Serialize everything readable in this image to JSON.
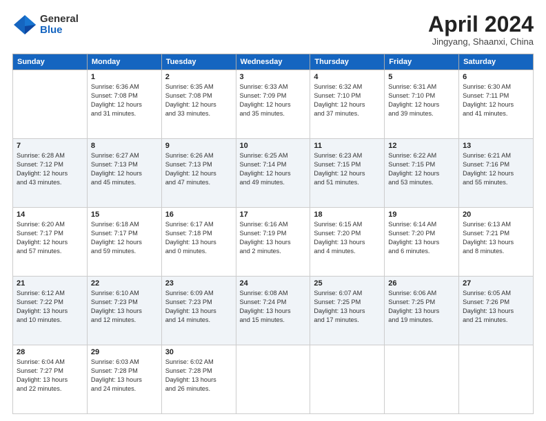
{
  "header": {
    "logo_general": "General",
    "logo_blue": "Blue",
    "title": "April 2024",
    "location": "Jingyang, Shaanxi, China"
  },
  "weekdays": [
    "Sunday",
    "Monday",
    "Tuesday",
    "Wednesday",
    "Thursday",
    "Friday",
    "Saturday"
  ],
  "weeks": [
    [
      {
        "day": "",
        "info": ""
      },
      {
        "day": "1",
        "info": "Sunrise: 6:36 AM\nSunset: 7:08 PM\nDaylight: 12 hours\nand 31 minutes."
      },
      {
        "day": "2",
        "info": "Sunrise: 6:35 AM\nSunset: 7:08 PM\nDaylight: 12 hours\nand 33 minutes."
      },
      {
        "day": "3",
        "info": "Sunrise: 6:33 AM\nSunset: 7:09 PM\nDaylight: 12 hours\nand 35 minutes."
      },
      {
        "day": "4",
        "info": "Sunrise: 6:32 AM\nSunset: 7:10 PM\nDaylight: 12 hours\nand 37 minutes."
      },
      {
        "day": "5",
        "info": "Sunrise: 6:31 AM\nSunset: 7:10 PM\nDaylight: 12 hours\nand 39 minutes."
      },
      {
        "day": "6",
        "info": "Sunrise: 6:30 AM\nSunset: 7:11 PM\nDaylight: 12 hours\nand 41 minutes."
      }
    ],
    [
      {
        "day": "7",
        "info": "Sunrise: 6:28 AM\nSunset: 7:12 PM\nDaylight: 12 hours\nand 43 minutes."
      },
      {
        "day": "8",
        "info": "Sunrise: 6:27 AM\nSunset: 7:13 PM\nDaylight: 12 hours\nand 45 minutes."
      },
      {
        "day": "9",
        "info": "Sunrise: 6:26 AM\nSunset: 7:13 PM\nDaylight: 12 hours\nand 47 minutes."
      },
      {
        "day": "10",
        "info": "Sunrise: 6:25 AM\nSunset: 7:14 PM\nDaylight: 12 hours\nand 49 minutes."
      },
      {
        "day": "11",
        "info": "Sunrise: 6:23 AM\nSunset: 7:15 PM\nDaylight: 12 hours\nand 51 minutes."
      },
      {
        "day": "12",
        "info": "Sunrise: 6:22 AM\nSunset: 7:15 PM\nDaylight: 12 hours\nand 53 minutes."
      },
      {
        "day": "13",
        "info": "Sunrise: 6:21 AM\nSunset: 7:16 PM\nDaylight: 12 hours\nand 55 minutes."
      }
    ],
    [
      {
        "day": "14",
        "info": "Sunrise: 6:20 AM\nSunset: 7:17 PM\nDaylight: 12 hours\nand 57 minutes."
      },
      {
        "day": "15",
        "info": "Sunrise: 6:18 AM\nSunset: 7:17 PM\nDaylight: 12 hours\nand 59 minutes."
      },
      {
        "day": "16",
        "info": "Sunrise: 6:17 AM\nSunset: 7:18 PM\nDaylight: 13 hours\nand 0 minutes."
      },
      {
        "day": "17",
        "info": "Sunrise: 6:16 AM\nSunset: 7:19 PM\nDaylight: 13 hours\nand 2 minutes."
      },
      {
        "day": "18",
        "info": "Sunrise: 6:15 AM\nSunset: 7:20 PM\nDaylight: 13 hours\nand 4 minutes."
      },
      {
        "day": "19",
        "info": "Sunrise: 6:14 AM\nSunset: 7:20 PM\nDaylight: 13 hours\nand 6 minutes."
      },
      {
        "day": "20",
        "info": "Sunrise: 6:13 AM\nSunset: 7:21 PM\nDaylight: 13 hours\nand 8 minutes."
      }
    ],
    [
      {
        "day": "21",
        "info": "Sunrise: 6:12 AM\nSunset: 7:22 PM\nDaylight: 13 hours\nand 10 minutes."
      },
      {
        "day": "22",
        "info": "Sunrise: 6:10 AM\nSunset: 7:23 PM\nDaylight: 13 hours\nand 12 minutes."
      },
      {
        "day": "23",
        "info": "Sunrise: 6:09 AM\nSunset: 7:23 PM\nDaylight: 13 hours\nand 14 minutes."
      },
      {
        "day": "24",
        "info": "Sunrise: 6:08 AM\nSunset: 7:24 PM\nDaylight: 13 hours\nand 15 minutes."
      },
      {
        "day": "25",
        "info": "Sunrise: 6:07 AM\nSunset: 7:25 PM\nDaylight: 13 hours\nand 17 minutes."
      },
      {
        "day": "26",
        "info": "Sunrise: 6:06 AM\nSunset: 7:25 PM\nDaylight: 13 hours\nand 19 minutes."
      },
      {
        "day": "27",
        "info": "Sunrise: 6:05 AM\nSunset: 7:26 PM\nDaylight: 13 hours\nand 21 minutes."
      }
    ],
    [
      {
        "day": "28",
        "info": "Sunrise: 6:04 AM\nSunset: 7:27 PM\nDaylight: 13 hours\nand 22 minutes."
      },
      {
        "day": "29",
        "info": "Sunrise: 6:03 AM\nSunset: 7:28 PM\nDaylight: 13 hours\nand 24 minutes."
      },
      {
        "day": "30",
        "info": "Sunrise: 6:02 AM\nSunset: 7:28 PM\nDaylight: 13 hours\nand 26 minutes."
      },
      {
        "day": "",
        "info": ""
      },
      {
        "day": "",
        "info": ""
      },
      {
        "day": "",
        "info": ""
      },
      {
        "day": "",
        "info": ""
      }
    ]
  ]
}
